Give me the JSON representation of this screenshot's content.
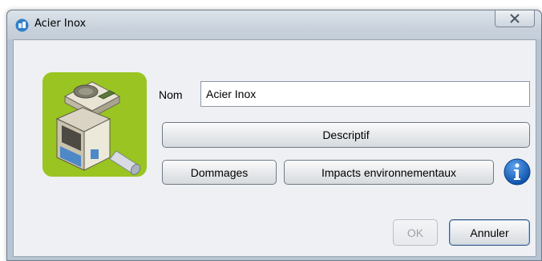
{
  "window": {
    "title": "Acier Inox",
    "close_glyph": "⨯"
  },
  "form": {
    "nom_label": "Nom",
    "nom_value": "Acier Inox"
  },
  "buttons": {
    "descriptif": "Descriptif",
    "dommages": "Dommages",
    "impacts": "Impacts environnementaux",
    "ok": "OK",
    "annuler": "Annuler"
  },
  "icons": {
    "app": "app-logo-icon",
    "close": "close-icon",
    "info": "info-icon",
    "illustration": "material-illustration"
  },
  "colors": {
    "accent_green": "#9ac421",
    "info_blue": "#1565c0"
  }
}
